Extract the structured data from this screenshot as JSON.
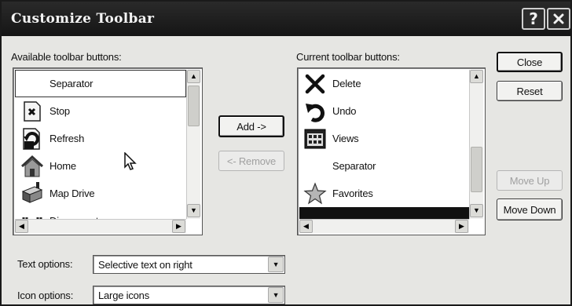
{
  "window": {
    "title": "Customize Toolbar",
    "help_glyph": "?",
    "close_glyph": "X"
  },
  "available": {
    "label": "Available toolbar buttons:",
    "items": [
      {
        "label": "Separator",
        "icon": "separator"
      },
      {
        "label": "Stop",
        "icon": "stop-icon"
      },
      {
        "label": "Refresh",
        "icon": "refresh-icon"
      },
      {
        "label": "Home",
        "icon": "home-icon"
      },
      {
        "label": "Map Drive",
        "icon": "map-drive-icon"
      },
      {
        "label": "Disconnect",
        "icon": "disconnect-icon"
      }
    ]
  },
  "current": {
    "label": "Current toolbar buttons:",
    "items": [
      {
        "label": "Delete",
        "icon": "delete-icon"
      },
      {
        "label": "Undo",
        "icon": "undo-icon"
      },
      {
        "label": "Views",
        "icon": "views-icon"
      },
      {
        "label": "Separator",
        "icon": "separator"
      },
      {
        "label": "Favorites",
        "icon": "favorites-icon"
      },
      {
        "label": "",
        "icon": "selected-item"
      }
    ]
  },
  "buttons": {
    "add": "Add ->",
    "remove": "<- Remove",
    "close": "Close",
    "reset": "Reset",
    "move_up": "Move Up",
    "move_down": "Move Down"
  },
  "options": {
    "text_label": "Text options:",
    "text_value": "Selective text on right",
    "icon_label": "Icon options:",
    "icon_value": "Large icons"
  }
}
